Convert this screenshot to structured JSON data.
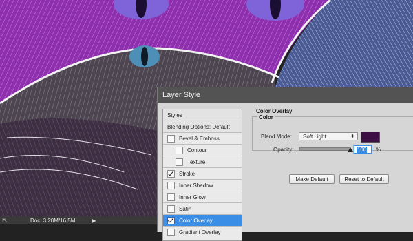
{
  "colors": {
    "accent": "#3a8ee6",
    "overlay_swatch": "#3d0f44",
    "titlebar": "#535353"
  },
  "status_bar": {
    "doc_info": "Doc: 3.20M/16.5M",
    "corner_icon": "export-icon",
    "arrow_icon": "play-arrow-icon"
  },
  "dialog": {
    "title": "Layer Style",
    "left_panel": {
      "styles_header": "Styles",
      "blending_options": "Blending Options: Default",
      "items": [
        {
          "label": "Bevel & Emboss",
          "checked": false,
          "indent": false
        },
        {
          "label": "Contour",
          "checked": false,
          "indent": true
        },
        {
          "label": "Texture",
          "checked": false,
          "indent": true
        },
        {
          "label": "Stroke",
          "checked": true,
          "indent": false
        },
        {
          "label": "Inner Shadow",
          "checked": false,
          "indent": false
        },
        {
          "label": "Inner Glow",
          "checked": false,
          "indent": false
        },
        {
          "label": "Satin",
          "checked": false,
          "indent": false
        },
        {
          "label": "Color Overlay",
          "checked": true,
          "indent": false,
          "selected": true
        },
        {
          "label": "Gradient Overlay",
          "checked": false,
          "indent": false
        }
      ]
    },
    "color_overlay": {
      "section_title": "Color Overlay",
      "group_title": "Color",
      "blend_mode_label": "Blend Mode:",
      "blend_mode_value": "Soft Light",
      "opacity_label": "Opacity:",
      "opacity_value": "100",
      "opacity_unit": "%",
      "opacity_fraction": 1.0,
      "make_default": "Make Default",
      "reset_default": "Reset to Default"
    }
  }
}
